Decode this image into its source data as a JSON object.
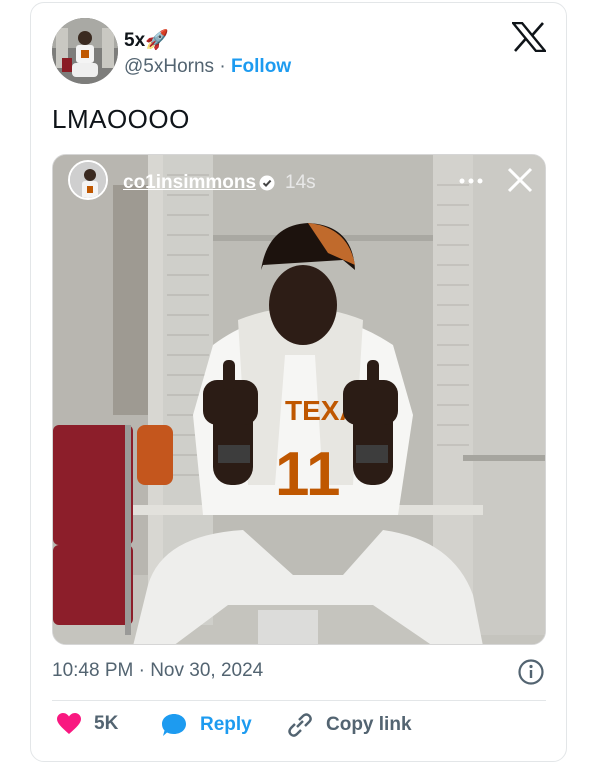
{
  "author": {
    "display_name": "5x",
    "emoji": "🚀",
    "handle": "@5xHorns",
    "separator": "·",
    "follow_label": "Follow"
  },
  "tweet": {
    "text": "LMAOOOO"
  },
  "media": {
    "story_username": "co1insimmons",
    "story_time": "14s",
    "jersey_text": "TEXA",
    "jersey_number": "11"
  },
  "meta": {
    "timestamp": "10:48 PM · Nov 30, 2024"
  },
  "actions": {
    "like_count": "5K",
    "reply_label": "Reply",
    "copy_link_label": "Copy link"
  },
  "colors": {
    "accent": "#1d9bf0",
    "like": "#f91880",
    "muted": "#536471",
    "burnt_orange": "#bf5700"
  },
  "icons": [
    "x-logo-icon",
    "verified-icon",
    "more-icon",
    "close-icon",
    "info-icon",
    "heart-icon",
    "reply-bubble-icon",
    "link-icon"
  ]
}
